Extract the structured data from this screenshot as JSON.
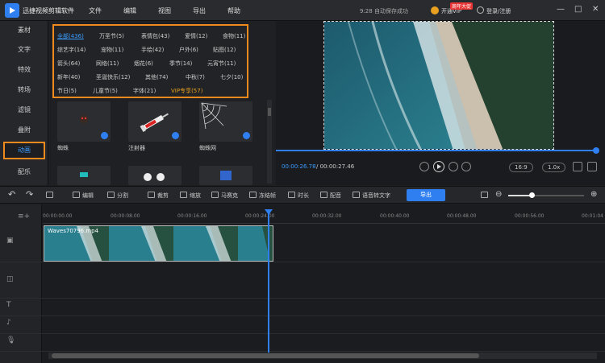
{
  "app": {
    "title": "迅捷视频剪辑软件",
    "save_status": "9:28 自动保存成功",
    "vip_label": "开通VIP",
    "vip_badge": "周年大促",
    "login": "登录/注册"
  },
  "menu": [
    "文件",
    "编辑",
    "视图",
    "导出",
    "帮助"
  ],
  "window_controls": [
    "—",
    "□",
    "✕"
  ],
  "sidebar": [
    {
      "label": "素材",
      "active": false
    },
    {
      "label": "文字",
      "active": false
    },
    {
      "label": "特效",
      "active": false
    },
    {
      "label": "转场",
      "active": false
    },
    {
      "label": "滤镜",
      "active": false
    },
    {
      "label": "叠附",
      "active": false
    },
    {
      "label": "动画",
      "active": true
    },
    {
      "label": "配乐",
      "active": false
    }
  ],
  "categories": [
    [
      "全部(436)",
      "万圣节(5)",
      "表情包(43)",
      "爱情(12)",
      "食物(11)"
    ],
    [
      "综艺字(14)",
      "宠物(11)",
      "手绘(42)",
      "户外(6)",
      "贴图(12)"
    ],
    [
      "箭头(64)",
      "网络(11)",
      "烟花(6)",
      "季节(14)",
      "元宵节(11)"
    ],
    [
      "新年(40)",
      "圣诞快乐(12)",
      "其他(74)",
      "中秋(7)",
      "七夕(10)"
    ],
    [
      "节日(5)",
      "儿童节(5)",
      "字体(21)",
      "VIP专享(57)"
    ]
  ],
  "library_items": [
    {
      "label": "蜘蛛"
    },
    {
      "label": "注射器"
    },
    {
      "label": "蜘蛛网"
    }
  ],
  "preview": {
    "time_current": "00:00:26.78",
    "time_total": "/ 00:00:27.46",
    "aspect": "16:9",
    "speed": "1.0x",
    "progress": 0.98
  },
  "toolbar": {
    "edit": "编辑",
    "split": "分割",
    "crop": "裁剪",
    "zoom": "缩放",
    "mosaic": "马赛克",
    "freeze": "冻结帧",
    "duration": "时长",
    "dub": "配音",
    "speech": "语音转文字",
    "export": "导出"
  },
  "ruler": [
    "00:00:00.00",
    "00:00:08.00",
    "00:00:16.00",
    "00:00:24.00",
    "00:00:32.00",
    "00:00:40.00",
    "00:00:48.00",
    "00:00:56.00",
    "00:01:04"
  ],
  "clip": {
    "name": "Waves70796.mp4"
  },
  "colors": {
    "accent": "#2f7ff0",
    "highlight": "#f08a1c"
  }
}
